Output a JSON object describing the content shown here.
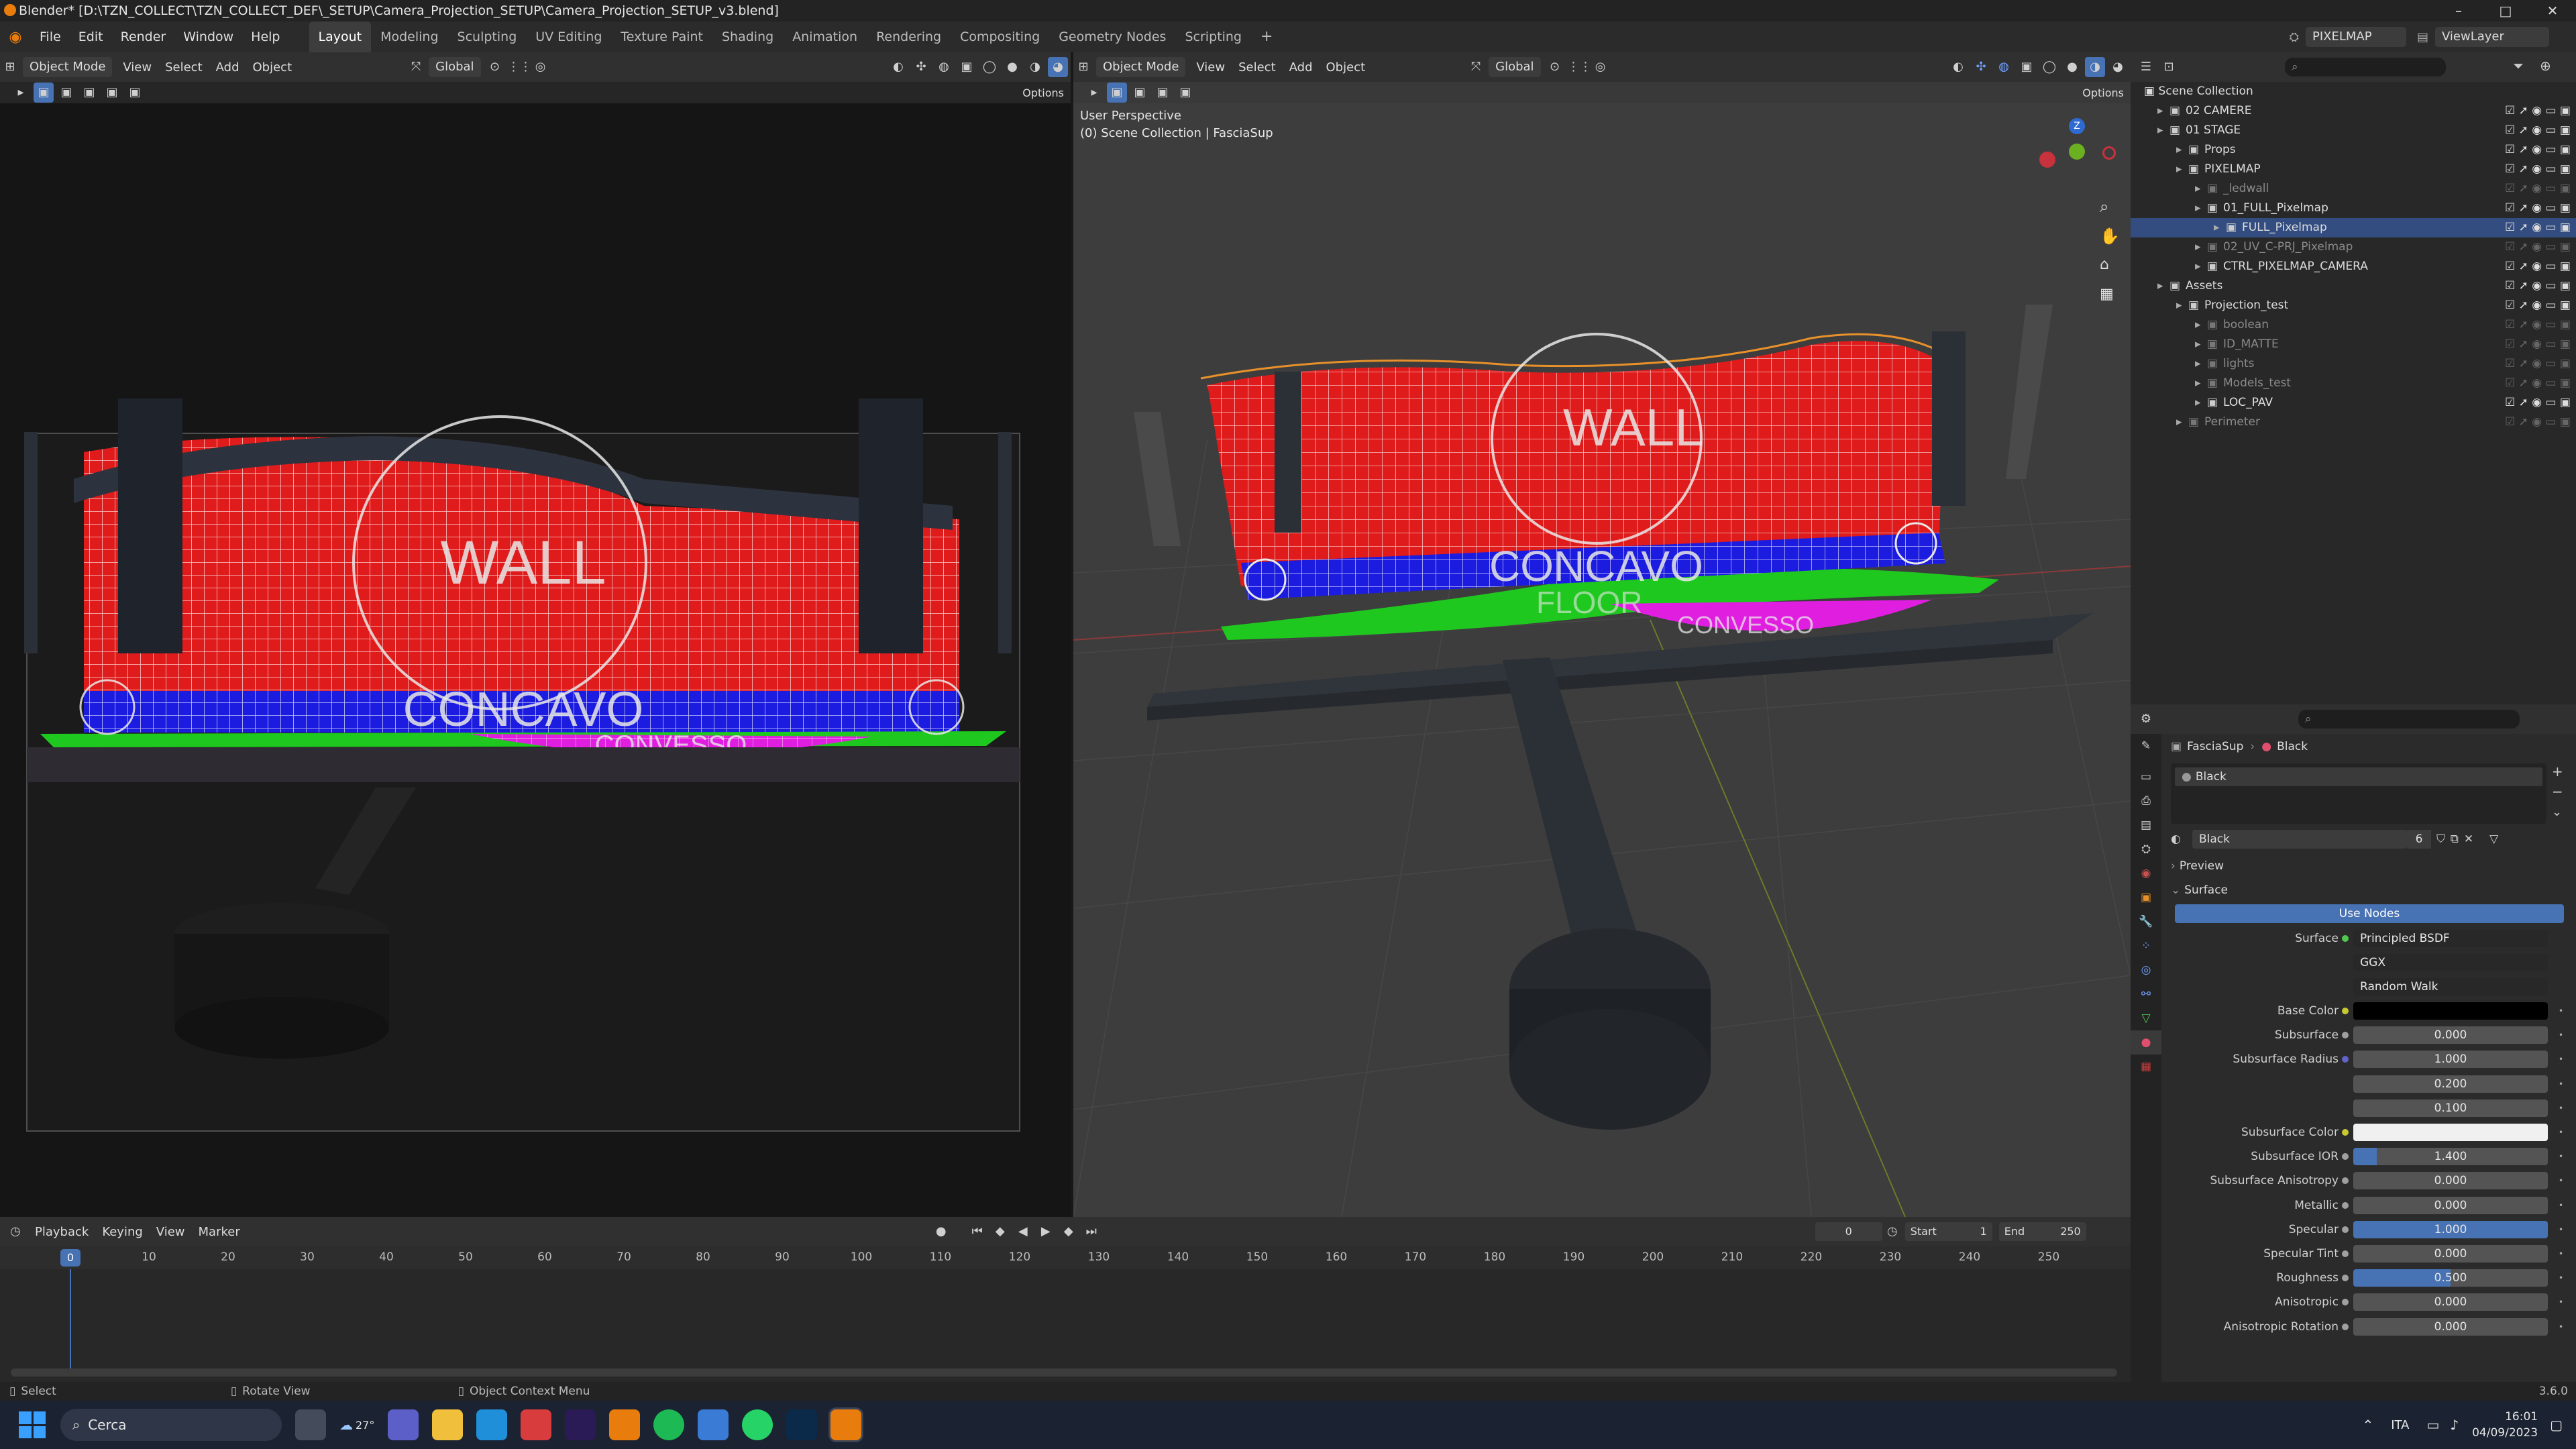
{
  "window": {
    "title": "Blender* [D:\\TZN_COLLECT\\TZN_COLLECT_DEF\\_SETUP\\Camera_Projection_SETUP\\Camera_Projection_SETUP_v3.blend]",
    "min": "–",
    "max": "□",
    "close": "✕"
  },
  "menu": [
    "File",
    "Edit",
    "Render",
    "Window",
    "Help"
  ],
  "workspaces": [
    "Layout",
    "Modeling",
    "Sculpting",
    "UV Editing",
    "Texture Paint",
    "Shading",
    "Animation",
    "Rendering",
    "Compositing",
    "Geometry Nodes",
    "Scripting"
  ],
  "scene_name": "PIXELMAP",
  "view_layer": "ViewLayer",
  "left_view": {
    "mode": "Object Mode",
    "menus": [
      "View",
      "Select",
      "Add",
      "Object"
    ],
    "orientation": "Global",
    "options": "Options"
  },
  "right_view": {
    "mode": "Object Mode",
    "menus": [
      "View",
      "Select",
      "Add",
      "Object"
    ],
    "orientation": "Global",
    "options": "Options",
    "info_line1": "User Perspective",
    "info_line2": "(0) Scene Collection | FasciaSup"
  },
  "stage_labels": {
    "wall": "WALL",
    "concavo": "CONCAVO",
    "floor": "FLOOR",
    "convesso": "CONVESSO"
  },
  "outliner": {
    "root": "Scene Collection",
    "items": [
      {
        "name": "02 CAMERE",
        "depth": 1,
        "dim": false,
        "sel": false
      },
      {
        "name": "01 STAGE",
        "depth": 1,
        "dim": false,
        "sel": false
      },
      {
        "name": "Props",
        "depth": 2,
        "dim": false,
        "sel": false
      },
      {
        "name": "PIXELMAP",
        "depth": 2,
        "dim": false,
        "sel": false
      },
      {
        "name": "_ledwall",
        "depth": 3,
        "dim": true,
        "sel": false
      },
      {
        "name": "01_FULL_Pixelmap",
        "depth": 3,
        "dim": false,
        "sel": false
      },
      {
        "name": "FULL_Pixelmap",
        "depth": 4,
        "dim": false,
        "sel": true
      },
      {
        "name": "02_UV_C-PRJ_Pixelmap",
        "depth": 3,
        "dim": true,
        "sel": false
      },
      {
        "name": "CTRL_PIXELMAP_CAMERA",
        "depth": 3,
        "dim": false,
        "sel": false
      },
      {
        "name": "Assets",
        "depth": 1,
        "dim": false,
        "sel": false
      },
      {
        "name": "Projection_test",
        "depth": 2,
        "dim": false,
        "sel": false
      },
      {
        "name": "boolean",
        "depth": 3,
        "dim": true,
        "sel": false
      },
      {
        "name": "ID_MATTE",
        "depth": 3,
        "dim": true,
        "sel": false
      },
      {
        "name": "lights",
        "depth": 3,
        "dim": true,
        "sel": false
      },
      {
        "name": "Models_test",
        "depth": 3,
        "dim": true,
        "sel": false
      },
      {
        "name": "LOC_PAV",
        "depth": 3,
        "dim": false,
        "sel": false
      },
      {
        "name": "Perimeter",
        "depth": 2,
        "dim": true,
        "sel": false
      }
    ]
  },
  "properties": {
    "breadcrumb_object": "FasciaSup",
    "breadcrumb_material": "Black",
    "slot_name": "Black",
    "material_name": "Black",
    "user_count": "6",
    "preview": "Preview",
    "surface_section": "Surface",
    "use_nodes": "Use Nodes",
    "surface_label": "Surface",
    "surface_value": "Principled BSDF",
    "distribution": "GGX",
    "subsurface_method": "Random Walk",
    "rows": [
      {
        "label": "Base Color",
        "value": "",
        "kind": "color_black",
        "dot": "#c8c832"
      },
      {
        "label": "Subsurface",
        "value": "0.000",
        "kind": "num",
        "dot": "#a0a0a0"
      },
      {
        "label": "Subsurface Radius",
        "value": "1.000",
        "kind": "num",
        "dot": "#6363c7"
      },
      {
        "label": "",
        "value": "0.200",
        "kind": "num",
        "dot": ""
      },
      {
        "label": "",
        "value": "0.100",
        "kind": "num",
        "dot": ""
      },
      {
        "label": "Subsurface Color",
        "value": "",
        "kind": "color_white",
        "dot": "#c8c832"
      },
      {
        "label": "Subsurface IOR",
        "value": "1.400",
        "kind": "num_partial",
        "dot": "#a0a0a0"
      },
      {
        "label": "Subsurface Anisotropy",
        "value": "0.000",
        "kind": "num",
        "dot": "#a0a0a0"
      },
      {
        "label": "Metallic",
        "value": "0.000",
        "kind": "num",
        "dot": "#a0a0a0"
      },
      {
        "label": "Specular",
        "value": "1.000",
        "kind": "num_full",
        "dot": "#a0a0a0"
      },
      {
        "label": "Specular Tint",
        "value": "0.000",
        "kind": "num",
        "dot": "#a0a0a0"
      },
      {
        "label": "Roughness",
        "value": "0.500",
        "kind": "num_half",
        "dot": "#a0a0a0"
      },
      {
        "label": "Anisotropic",
        "value": "0.000",
        "kind": "num",
        "dot": "#a0a0a0"
      },
      {
        "label": "Anisotropic Rotation",
        "value": "0.000",
        "kind": "num",
        "dot": "#a0a0a0"
      }
    ]
  },
  "timeline": {
    "menus": [
      "Playback",
      "Keying",
      "View",
      "Marker"
    ],
    "current_frame": "0",
    "start_label": "Start",
    "start": "1",
    "end_label": "End",
    "end": "250",
    "ticks": [
      "0",
      "10",
      "20",
      "30",
      "40",
      "50",
      "60",
      "70",
      "80",
      "90",
      "100",
      "110",
      "120",
      "130",
      "140",
      "150",
      "160",
      "170",
      "180",
      "190",
      "200",
      "210",
      "220",
      "230",
      "240",
      "250"
    ],
    "playhead": "0"
  },
  "status": {
    "select": "Select",
    "rotate": "Rotate View",
    "context": "Object Context Menu",
    "version": "3.6.0"
  },
  "taskbar": {
    "search": "Cerca",
    "weather": "27°",
    "lang": "ITA",
    "time": "16:01",
    "date": "04/09/2023"
  }
}
